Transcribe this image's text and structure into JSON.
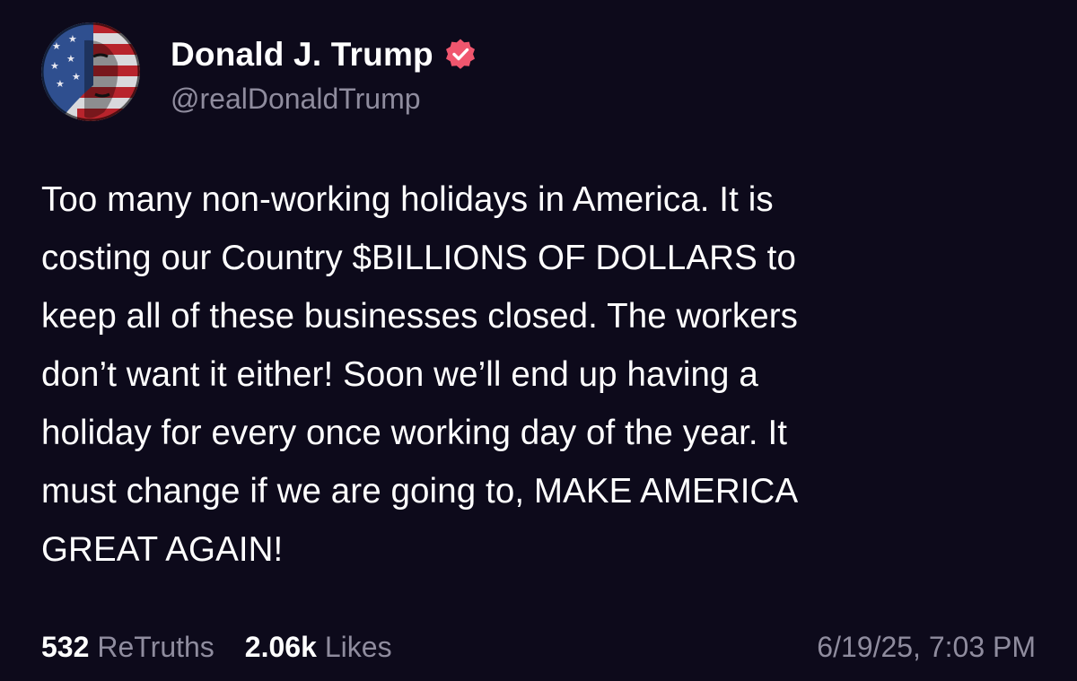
{
  "author": {
    "display_name": "Donald J. Trump",
    "handle": "@realDonaldTrump",
    "verified": true,
    "verified_color": "#f0566e"
  },
  "post": {
    "text": "Too many non-working holidays in America. It is\ncosting our Country $BILLIONS OF DOLLARS to\nkeep all of these businesses closed. The workers\ndon’t want it either! Soon we’ll end up having a\nholiday for every once working day of the year. It\nmust change if we are going to, MAKE AMERICA\nGREAT AGAIN!"
  },
  "stats": {
    "retruths_count": "532",
    "retruths_label": "ReTruths",
    "likes_count": "2.06k",
    "likes_label": "Likes"
  },
  "timestamp": "6/19/25, 7:03 PM",
  "colors": {
    "background": "#0d0a1b",
    "text": "#ffffff",
    "muted": "#8f8c9e"
  }
}
